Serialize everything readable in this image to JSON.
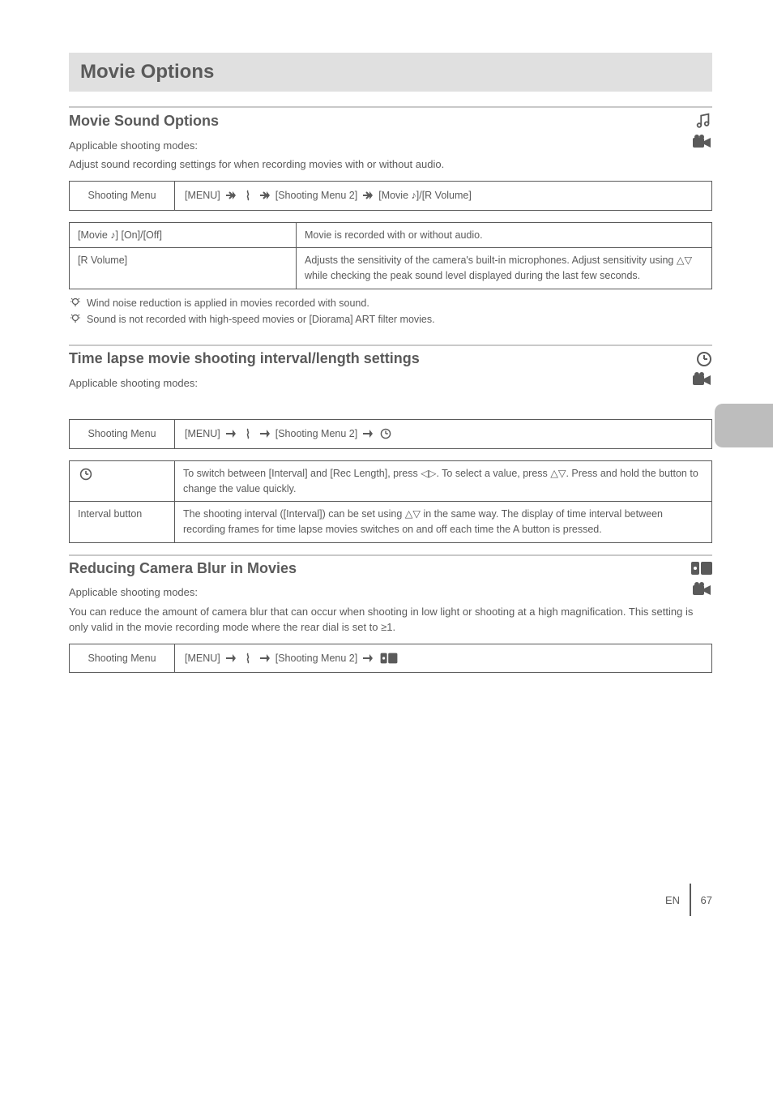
{
  "page": {
    "title": "Movie Options",
    "footer_text": "EN",
    "page_number": "67"
  },
  "sound": {
    "heading": "Movie Sound Options",
    "icon_label": "R",
    "modes": "Applicable shooting modes:",
    "body": "Adjust sound recording settings for when recording movies with or without audio.",
    "nav_label": "Shooting Menu",
    "nav_path_segments": [
      "[MENU]",
      "[Shooting Menu 2]",
      "[Movie ♪]/[R Volume]"
    ],
    "options": [
      {
        "name": "[Movie ♪] [On]/[Off]",
        "desc": "Movie is recorded with or without audio."
      },
      {
        "name": "[R Volume]",
        "desc": "Adjusts the sensitivity of the camera's built-in microphones. Adjust sensitivity using △▽ while checking the peak sound level displayed during the last few seconds."
      }
    ],
    "tips": [
      "Wind noise reduction is applied in movies recorded with sound.",
      "Sound is not recorded with high-speed movies or [Diorama] ART filter movies."
    ]
  },
  "timelapse": {
    "heading": "Time lapse movie shooting interval/length settings",
    "clock_label": "Clock",
    "modes": "Applicable shooting modes:",
    "nav_label": "Shooting Menu",
    "nav_path_segments": [
      "[MENU]",
      "[Shooting Menu 2]",
      "Clock"
    ],
    "options": [
      {
        "name": "Clock",
        "desc": "To switch between [Interval] and [Rec Length], press ◁▷. To select a value, press △▽. Press and hold the button to change the value quickly."
      },
      {
        "name": "Interval button",
        "desc": "The shooting interval ([Interval]) can be set using △▽ in the same way. The display of time interval between recording frames for time lapse movies switches on and off each time the A button is pressed."
      }
    ]
  },
  "is": {
    "heading": "Reducing Camera Blur in Movies",
    "icon_label": "IS",
    "modes": "Applicable shooting modes:",
    "body": "You can reduce the amount of camera blur that can occur when shooting in low light or shooting at a high magnification. This setting is only valid in the movie recording mode where the rear dial is set to ≥1.",
    "nav_label": "Shooting Menu",
    "nav_path_segments": [
      "[MENU]",
      "[Shooting Menu 2]",
      "IS"
    ]
  }
}
